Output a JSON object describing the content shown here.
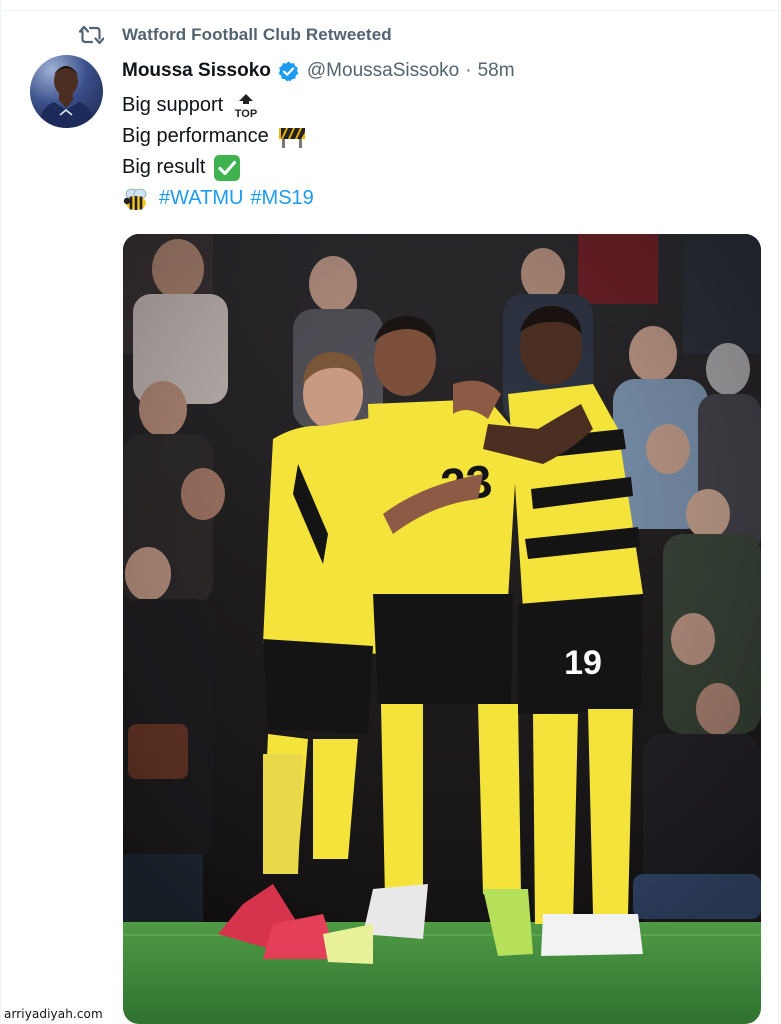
{
  "retweet_context": {
    "icon": "retweet-icon",
    "text": "Watford Football Club Retweeted"
  },
  "author": {
    "display_name": "Moussa Sissoko",
    "handle": "@MoussaSissoko",
    "separator": "·",
    "time": "58m",
    "verified_icon": "verified-badge-icon"
  },
  "tweet": {
    "lines": [
      {
        "text": "Big support",
        "emoji": "top-arrow-emoji"
      },
      {
        "text": "Big performance",
        "emoji": "construction-barrier-emoji"
      },
      {
        "text": "Big result",
        "emoji": "check-mark-button-emoji"
      }
    ],
    "hashtag_line": {
      "emoji": "honeybee-emoji",
      "hashtags": [
        "#WATMU",
        "#MS19"
      ]
    }
  },
  "media": {
    "kind": "photo",
    "jersey_numbers_visible": [
      "19"
    ]
  },
  "watermark": "arriyadiyah.com",
  "colors": {
    "link": "#1d9bf0",
    "secondary_text": "#536471",
    "primary_text": "#0f1419",
    "kit_yellow": "#f3e33a",
    "kit_black": "#141414",
    "pitch_green": "#3f8a3a"
  }
}
